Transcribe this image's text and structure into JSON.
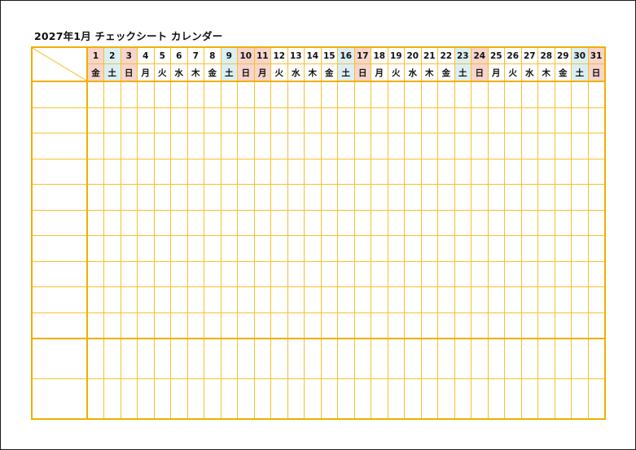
{
  "title": "2027年1月 チェックシート カレンダー",
  "colors": {
    "grid": "#f5c030",
    "grid_bold": "#f0b000",
    "saturday_bg": "#dbeff3",
    "sunday_holiday_bg": "#f7d5cb"
  },
  "days": [
    {
      "date": "1",
      "weekday": "金",
      "type": "holiday"
    },
    {
      "date": "2",
      "weekday": "土",
      "type": "sat"
    },
    {
      "date": "3",
      "weekday": "日",
      "type": "sun"
    },
    {
      "date": "4",
      "weekday": "月",
      "type": "weekday"
    },
    {
      "date": "5",
      "weekday": "火",
      "type": "weekday"
    },
    {
      "date": "6",
      "weekday": "水",
      "type": "weekday"
    },
    {
      "date": "7",
      "weekday": "木",
      "type": "weekday"
    },
    {
      "date": "8",
      "weekday": "金",
      "type": "weekday"
    },
    {
      "date": "9",
      "weekday": "土",
      "type": "sat"
    },
    {
      "date": "10",
      "weekday": "日",
      "type": "sun"
    },
    {
      "date": "11",
      "weekday": "月",
      "type": "holiday"
    },
    {
      "date": "12",
      "weekday": "火",
      "type": "weekday"
    },
    {
      "date": "13",
      "weekday": "水",
      "type": "weekday"
    },
    {
      "date": "14",
      "weekday": "木",
      "type": "weekday"
    },
    {
      "date": "15",
      "weekday": "金",
      "type": "weekday"
    },
    {
      "date": "16",
      "weekday": "土",
      "type": "sat"
    },
    {
      "date": "17",
      "weekday": "日",
      "type": "sun"
    },
    {
      "date": "18",
      "weekday": "月",
      "type": "weekday"
    },
    {
      "date": "19",
      "weekday": "火",
      "type": "weekday"
    },
    {
      "date": "20",
      "weekday": "水",
      "type": "weekday"
    },
    {
      "date": "21",
      "weekday": "木",
      "type": "weekday"
    },
    {
      "date": "22",
      "weekday": "金",
      "type": "weekday"
    },
    {
      "date": "23",
      "weekday": "土",
      "type": "sat"
    },
    {
      "date": "24",
      "weekday": "日",
      "type": "sun"
    },
    {
      "date": "25",
      "weekday": "月",
      "type": "weekday"
    },
    {
      "date": "26",
      "weekday": "火",
      "type": "weekday"
    },
    {
      "date": "27",
      "weekday": "水",
      "type": "weekday"
    },
    {
      "date": "28",
      "weekday": "木",
      "type": "weekday"
    },
    {
      "date": "29",
      "weekday": "金",
      "type": "weekday"
    },
    {
      "date": "30",
      "weekday": "土",
      "type": "sat"
    },
    {
      "date": "31",
      "weekday": "日",
      "type": "sun"
    }
  ],
  "rows": {
    "check_rows": [
      "",
      "",
      "",
      "",
      "",
      "",
      "",
      "",
      "",
      ""
    ],
    "note_rows": [
      "",
      ""
    ]
  }
}
